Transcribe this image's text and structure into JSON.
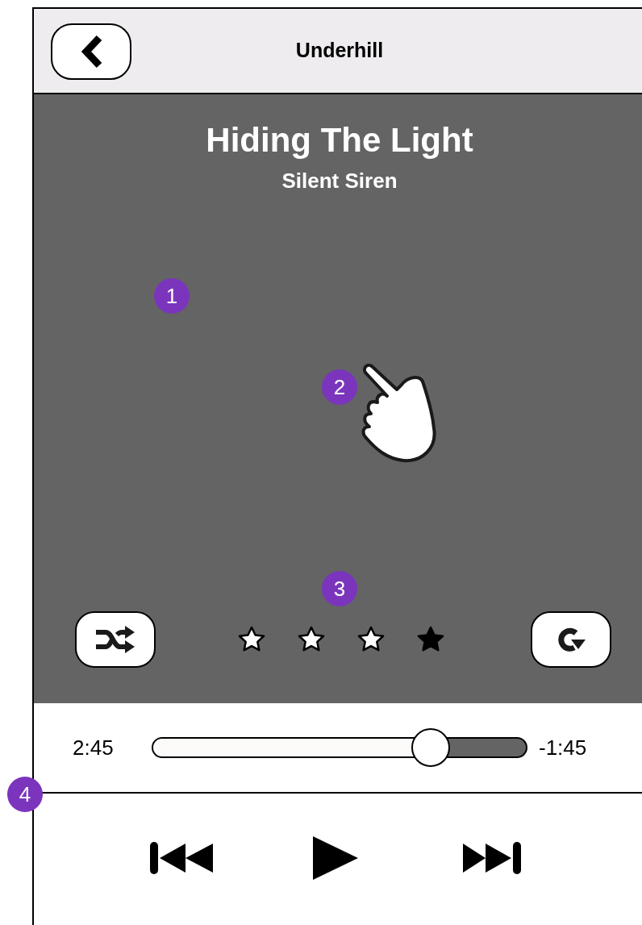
{
  "header": {
    "title": "Underhill"
  },
  "song": {
    "title": "Hiding The Light",
    "artist": "Silent Siren"
  },
  "rating": [
    {
      "filled": false
    },
    {
      "filled": false
    },
    {
      "filled": false
    },
    {
      "filled": true
    }
  ],
  "progress": {
    "elapsed": "2:45",
    "remaining": "-1:45",
    "level": 0.745
  },
  "markers": [
    "1",
    "2",
    "3",
    "4"
  ]
}
